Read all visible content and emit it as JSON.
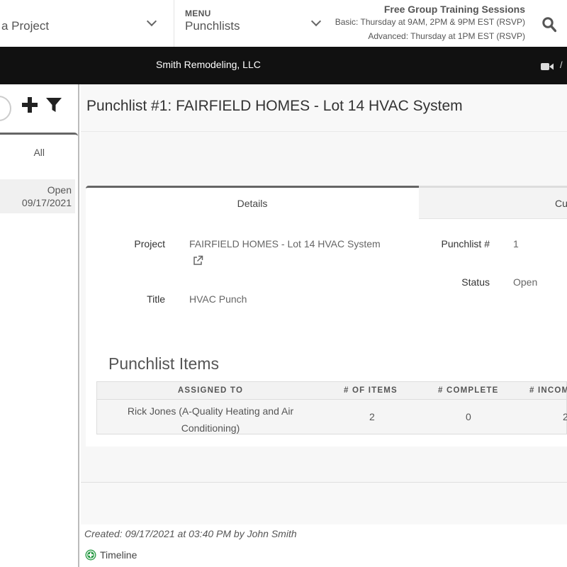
{
  "topbar": {
    "project_select_label": "a Project",
    "menu_caption": "MENU",
    "menu_value": "Punchlists",
    "training_title": "Free Group Training Sessions",
    "training_basic": "Basic: Thursday at 9AM, 2PM & 9PM EST (RSVP)",
    "training_advanced": "Advanced: Thursday at 1PM EST (RSVP)"
  },
  "company": {
    "name": "Smith Remodeling, LLC",
    "separator": "/"
  },
  "sidebar": {
    "filter_label": "All",
    "items": [
      {
        "status": "Open",
        "date": "09/17/2021"
      }
    ]
  },
  "page": {
    "title": "Punchlist #1: FAIRFIELD HOMES - Lot 14 HVAC System",
    "tabs": [
      {
        "label": "Details"
      },
      {
        "label": "Cu"
      }
    ]
  },
  "details": {
    "project_label": "Project",
    "project_value": "FAIRFIELD HOMES - Lot 14 HVAC System",
    "punchlist_no_label": "Punchlist #",
    "punchlist_no_value": "1",
    "status_label": "Status",
    "status_value": "Open",
    "title_label": "Title",
    "title_value": "HVAC Punch"
  },
  "punchlist_items": {
    "heading": "Punchlist Items",
    "columns": [
      "ASSIGNED TO",
      "# OF ITEMS",
      "# COMPLETE",
      "# INCOM"
    ],
    "rows": [
      {
        "assigned_to": "Rick Jones (A-Quality Heating and Air Conditioning)",
        "items": "2",
        "complete": "0",
        "incomplete": "2"
      }
    ]
  },
  "footer": {
    "created": "Created: 09/17/2021 at 03:40 PM by John Smith",
    "timeline": "Timeline"
  },
  "colors": {
    "company_bar": "#111111",
    "timeline_icon": "#2e9e4a"
  }
}
